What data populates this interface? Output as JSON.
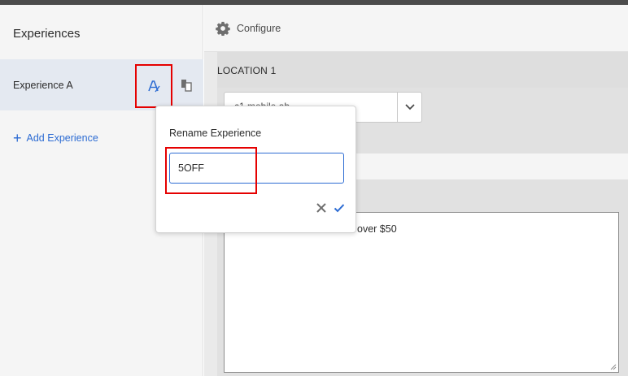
{
  "sidebar": {
    "title": "Experiences",
    "experiences": [
      {
        "label": "Experience A",
        "selected": true
      }
    ],
    "add_label": "Add Experience",
    "icons": {
      "rename": "rename-icon",
      "duplicate": "duplicate-icon",
      "add": "plus-icon"
    }
  },
  "main": {
    "configure_label": "Configure",
    "configure_icon": "gear-icon",
    "location": {
      "title": "LOCATION 1",
      "select_value": "c1 mobile ab"
    },
    "content": {
      "text": "over $50"
    }
  },
  "rename_popover": {
    "title": "Rename Experience",
    "input_value": "5OFF",
    "cancel_icon": "close-icon",
    "confirm_icon": "checkmark-icon"
  },
  "colors": {
    "accent": "#2d6cd3",
    "highlight": "#e50000",
    "selected_row": "#e4e9f1"
  }
}
